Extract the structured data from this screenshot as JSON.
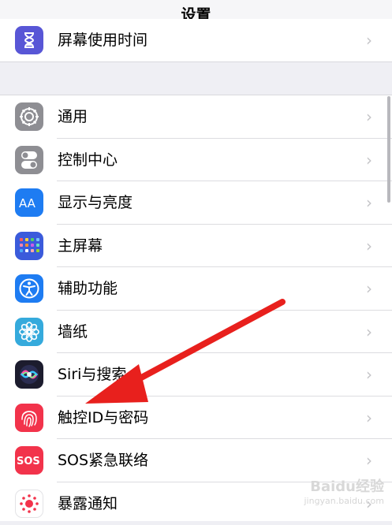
{
  "nav": {
    "title": "设置"
  },
  "top_group": [
    {
      "label": "屏幕使用时间",
      "icon": "hourglass-icon",
      "color": "#5856d6"
    }
  ],
  "main_group": [
    {
      "label": "通用",
      "icon": "gear-icon",
      "color": "#8e8e93"
    },
    {
      "label": "控制中心",
      "icon": "toggles-icon",
      "color": "#8e8e93"
    },
    {
      "label": "显示与亮度",
      "icon": "text-size-icon",
      "color": "#1e7cf2"
    },
    {
      "label": "主屏幕",
      "icon": "app-grid-icon",
      "color": "#3b5bdb"
    },
    {
      "label": "辅助功能",
      "icon": "accessibility-icon",
      "color": "#1e7cf2"
    },
    {
      "label": "墙纸",
      "icon": "flower-icon",
      "color": "#35aadc"
    },
    {
      "label": "Siri与搜索",
      "icon": "siri-icon",
      "color": "#1c1c2e"
    },
    {
      "label": "触控ID与密码",
      "icon": "fingerprint-icon",
      "color": "#f2334b"
    },
    {
      "label": "SOS紧急联络",
      "icon": "sos-icon",
      "color": "#f2334b"
    },
    {
      "label": "暴露通知",
      "icon": "exposure-icon",
      "color": "#ffffff"
    }
  ],
  "chevron": "›",
  "annotation": {
    "arrow_color": "#e8201d"
  },
  "watermark": {
    "main": "Baidu经验",
    "sub": "jingyan.baidu.com"
  }
}
